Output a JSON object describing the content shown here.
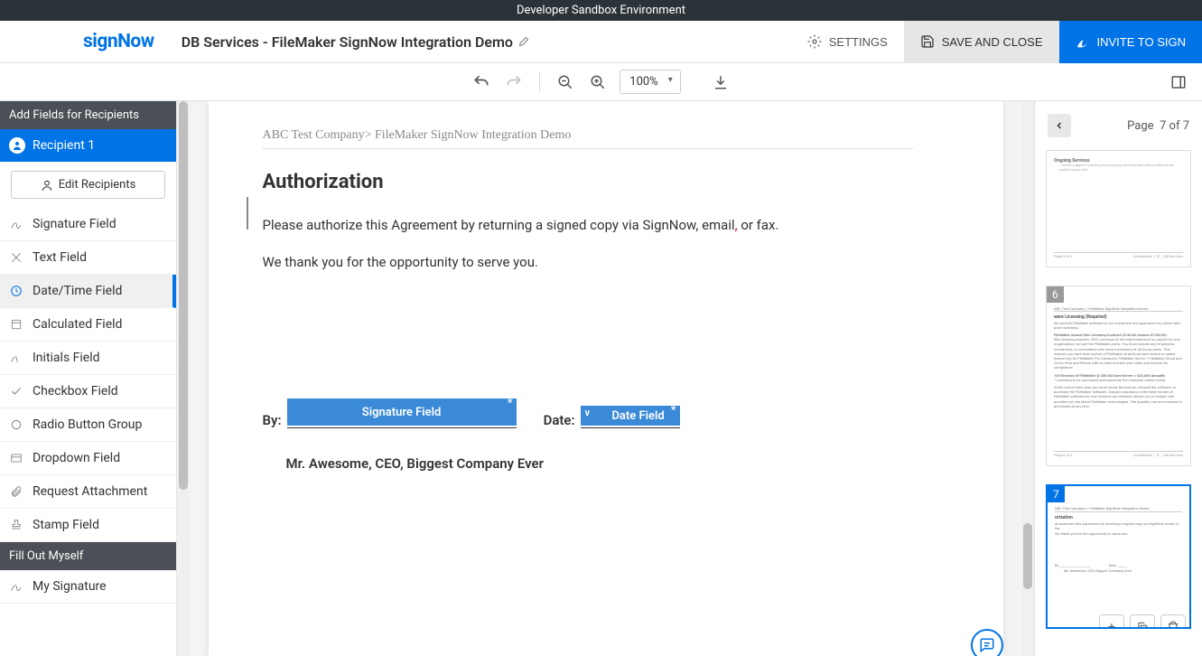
{
  "sandbox_label": "Developer Sandbox Environment",
  "logo_text": "signNow",
  "doc_title": "DB Services - FileMaker SignNow Integration Demo",
  "header_buttons": {
    "settings": "SETTINGS",
    "save": "SAVE AND CLOSE",
    "invite": "INVITE TO SIGN"
  },
  "toolbar": {
    "zoom_value": "100%"
  },
  "sidebar": {
    "add_fields_header": "Add Fields for Recipients",
    "recipient_label": "Recipient 1",
    "edit_recipients": "Edit Recipients",
    "fields": [
      "Signature Field",
      "Text Field",
      "Date/Time Field",
      "Calculated Field",
      "Initials Field",
      "Checkbox Field",
      "Radio Button Group",
      "Dropdown Field",
      "Request Attachment",
      "Stamp Field"
    ],
    "fill_out_header": "Fill Out Myself",
    "my_fields": [
      "My Signature"
    ]
  },
  "document": {
    "breadcrumb": "ABC Test Company> FileMaker SignNow Integration Demo",
    "heading": "Authorization",
    "para1_a": "Please authorize this Agreement by returning a signed copy via SignNow, email",
    "para1_b": " or fax.",
    "para2": "We thank you for the opportunity to serve you.",
    "by_label": "By:",
    "date_label": "Date:",
    "signature_field_label": "Signature Field",
    "date_field_label": "Date Field",
    "signer_name": "Mr. Awesome, CEO, Biggest Company Ever"
  },
  "thumbs": {
    "page_label": "Page",
    "page_value": "7 of 7",
    "page_numbers": [
      "6",
      "7"
    ]
  }
}
